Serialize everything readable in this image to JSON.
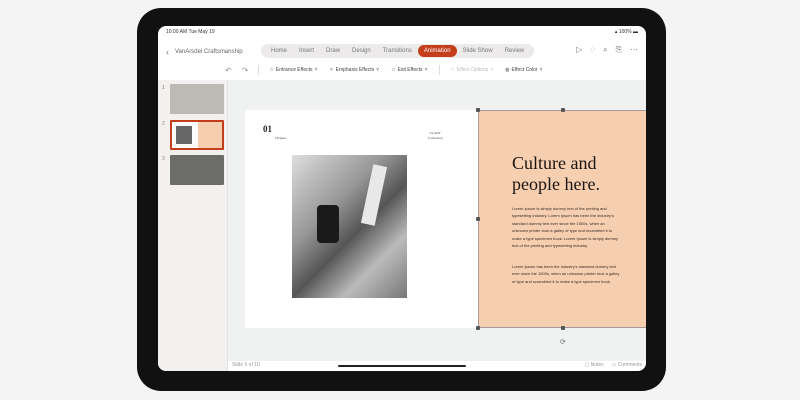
{
  "status": {
    "time": "10:00 AM",
    "date": "Tue May 19",
    "battery": "100%"
  },
  "document_title": "VanArsdel Craftsmanship",
  "tabs": [
    {
      "label": "Home"
    },
    {
      "label": "Insert"
    },
    {
      "label": "Draw"
    },
    {
      "label": "Design"
    },
    {
      "label": "Transitions"
    },
    {
      "label": "Animation",
      "active": true
    },
    {
      "label": "Slide Show"
    },
    {
      "label": "Review"
    }
  ],
  "toolbar": {
    "entrance": "Entrance Effects",
    "emphasis": "Emphasis Effects",
    "exit": "Exit Effects",
    "options": "Effect Options",
    "color": "Effect Color"
  },
  "thumbnails": [
    {
      "num": "1"
    },
    {
      "num": "2"
    },
    {
      "num": "3"
    }
  ],
  "slide": {
    "number": "01",
    "chapter": "Chapter",
    "collection_top": "SLANT",
    "collection": "Collection",
    "heading": "Culture and people here.",
    "para1": "Lorem Ipsum is simply dummy text of the printing and typesetting industry. Lorem Ipsum has been the industry's standard dummy text ever since the 1500s, when an unknown printer took a galley of type and scrambled it to make a type specimen book. Lorem Ipsum is simply dummy text of the printing and typesetting industry.",
    "para2": "Lorem Ipsum has been the industry's standard dummy text ever since the 1500s, when an unknown printer took a galley of type and scrambled it to make a type specimen book."
  },
  "footer": {
    "slide_count": "Slide 5 of 10",
    "notes": "Notes",
    "comments": "Comments"
  },
  "colors": {
    "accent": "#c43e1c",
    "peach": "#f6cfb0"
  }
}
